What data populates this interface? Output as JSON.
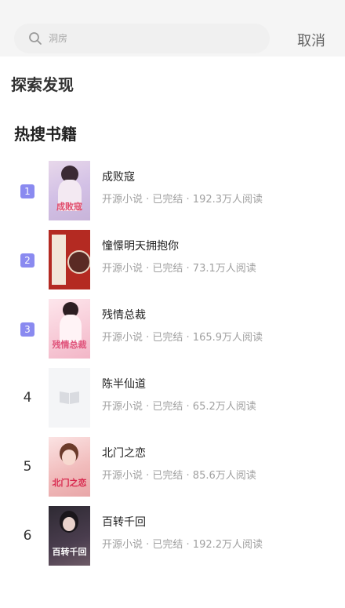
{
  "search": {
    "placeholder": "洞房",
    "cancel_label": "取消"
  },
  "sections": {
    "discover": "探索发现",
    "hot_books": "热搜书籍"
  },
  "books": [
    {
      "rank": "1",
      "title": "成败寇",
      "meta": "开源小说 · 已完结 · 192.3万人阅读",
      "cover_text": "成败寇"
    },
    {
      "rank": "2",
      "title": "憧憬明天拥抱你",
      "meta": "开源小说 · 已完结 · 73.1万人阅读",
      "cover_text": ""
    },
    {
      "rank": "3",
      "title": "残情总裁",
      "meta": "开源小说 · 已完结 · 165.9万人阅读",
      "cover_text": "残情总裁"
    },
    {
      "rank": "4",
      "title": "陈半仙道",
      "meta": "开源小说 · 已完结 · 65.2万人阅读",
      "cover_text": ""
    },
    {
      "rank": "5",
      "title": "北门之恋",
      "meta": "开源小说 · 已完结 · 85.6万人阅读",
      "cover_text": "北门之恋"
    },
    {
      "rank": "6",
      "title": "百转千回",
      "meta": "开源小说 · 已完结 · 192.2万人阅读",
      "cover_text": "百转千回"
    }
  ],
  "colors": {
    "rank_badge": "#8a8af0",
    "meta_text": "#a0a0a0"
  },
  "icons": {
    "search": "search-icon",
    "placeholder_cover": "book-icon"
  }
}
